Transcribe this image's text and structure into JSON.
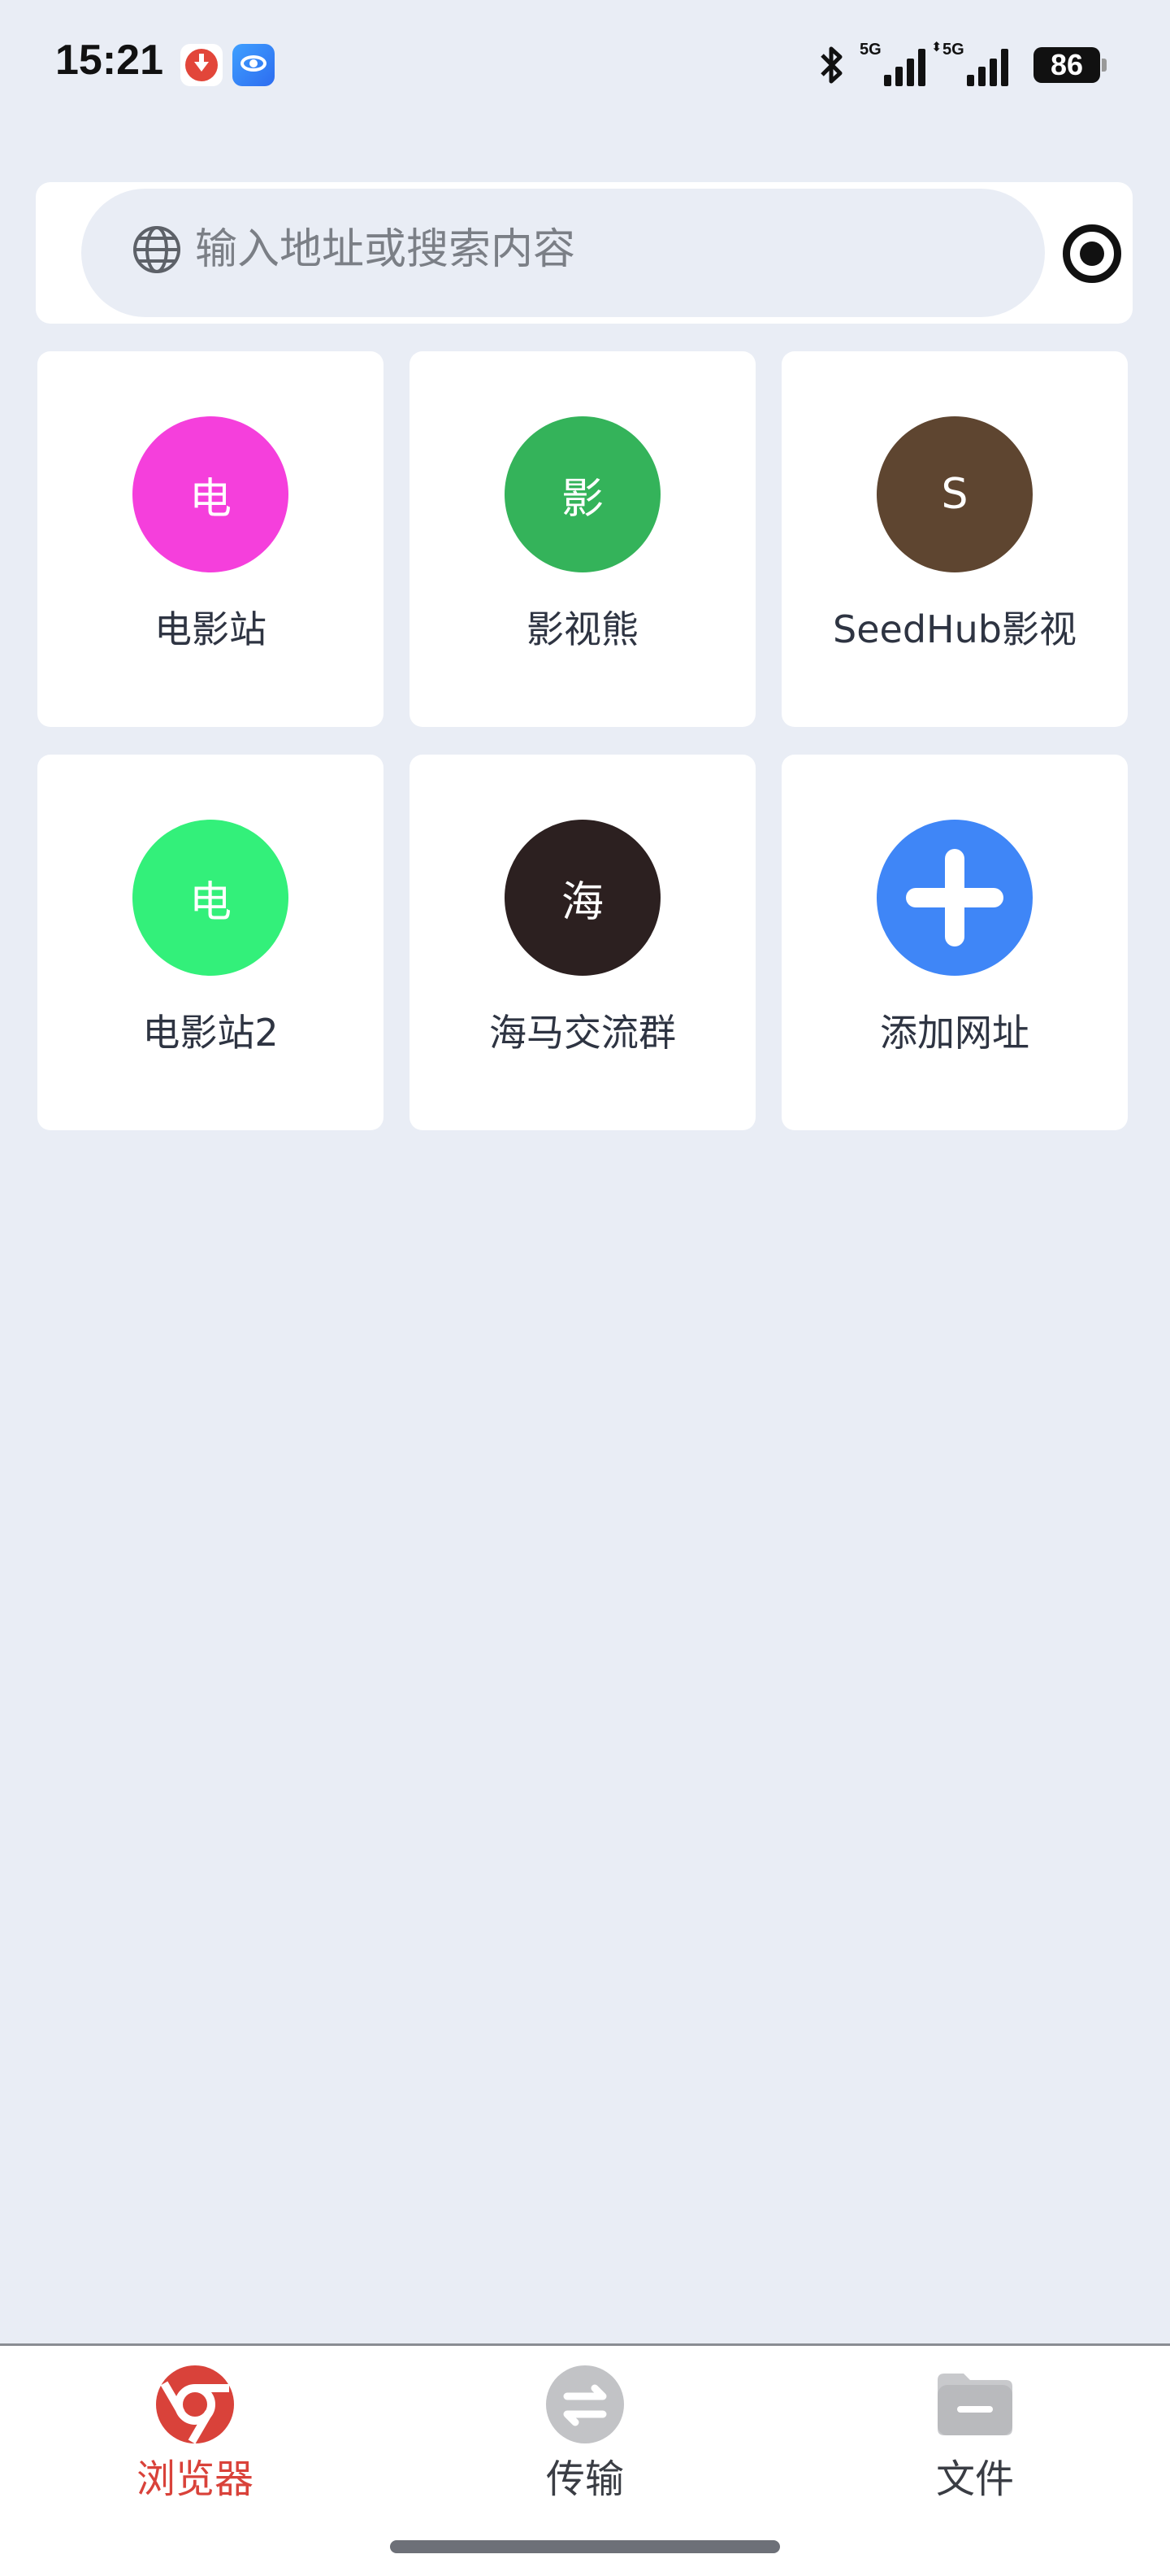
{
  "status_bar": {
    "time": "15:21",
    "signal_1_label": "5G",
    "signal_2_label": "5G",
    "battery": "86",
    "icons": [
      "download-app-icon",
      "eye-app-icon",
      "bluetooth-icon",
      "signal-icon",
      "battery-icon"
    ]
  },
  "search": {
    "placeholder": "输入地址或搜索内容",
    "icon": "globe-icon",
    "action_icon": "record-target-icon"
  },
  "tiles": [
    {
      "letter": "电",
      "label": "电影站",
      "color": "#f53fdc"
    },
    {
      "letter": "影",
      "label": "影视熊",
      "color": "#34b35a"
    },
    {
      "letter": "S",
      "label": "SeedHub影视",
      "color": "#5e4530"
    },
    {
      "letter": "电",
      "label": "电影站2",
      "color": "#33f07a"
    },
    {
      "letter": "海",
      "label": "海马交流群",
      "color": "#2c2020"
    },
    {
      "letter": "",
      "label": "添加网址",
      "color": "#3f86f7"
    }
  ],
  "bottom_nav": {
    "items": [
      {
        "label": "浏览器",
        "icon": "browser-icon",
        "active": true
      },
      {
        "label": "传输",
        "icon": "transfer-icon",
        "active": false
      },
      {
        "label": "文件",
        "icon": "folder-icon",
        "active": false
      }
    ],
    "active_color": "#d9423a"
  }
}
